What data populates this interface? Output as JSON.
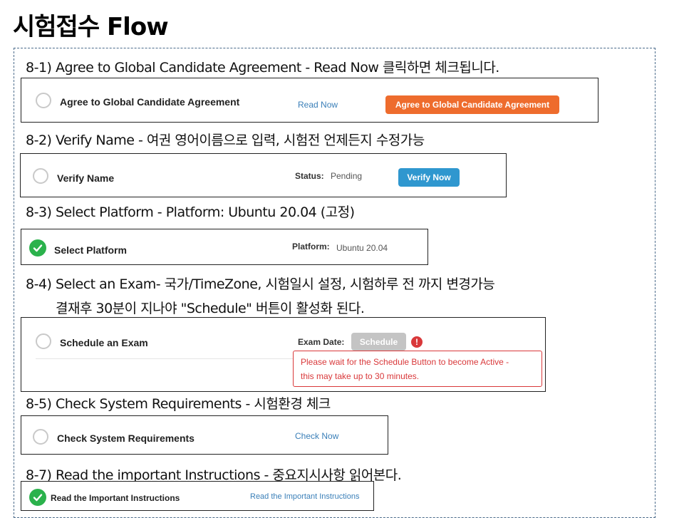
{
  "title": "시험접수 Flow",
  "steps": {
    "s1": "8-1) Agree to Global Candidate Agreement - Read Now 클릭하면 체크됩니다.",
    "s2": "8-2) Verify Name - 여권 영어이름으로 입력, 시험전 언제든지 수정가능",
    "s3": "8-3) Select Platform - Platform: Ubuntu 20.04 (고정)",
    "s4": "8-4) Select an Exam- 국가/TimeZone, 시험일시 설정, 시험하루 전 까지 변경가능",
    "s4b": "결재후 30분이 지나야 \"Schedule\" 버튼이 활성화 된다.",
    "s5": "8-5) Check System Requirements - 시험환경 체크",
    "s7": "8-7) Read the important Instructions - 중요지시사항 읽어본다."
  },
  "cards": {
    "agreement": {
      "title": "Agree to Global Candidate Agreement",
      "link": "Read Now",
      "button": "Agree to Global Candidate Agreement",
      "button_color": "#ee6c2d"
    },
    "verify": {
      "title": "Verify Name",
      "status_label": "Status:",
      "status_value": "Pending",
      "button": "Verify Now",
      "button_color": "#2f97cf"
    },
    "platform": {
      "title": "Select Platform",
      "platform_label": "Platform:",
      "platform_value": "Ubuntu 20.04",
      "check_color": "#2bb24c"
    },
    "exam": {
      "title": "Schedule an Exam",
      "date_label": "Exam Date:",
      "button": "Schedule",
      "button_color": "#c4c4c4",
      "warning_glyph": "!",
      "tooltip_line1": "Please wait for the Schedule Button to become Active -",
      "tooltip_line2": "this may take up to 30 minutes.",
      "warning_color": "#d9383a"
    },
    "system": {
      "title": "Check System Requirements",
      "link": "Check Now"
    },
    "instructions": {
      "title": "Read the Important Instructions",
      "link": "Read the Important Instructions",
      "check_color": "#2bb24c"
    }
  }
}
